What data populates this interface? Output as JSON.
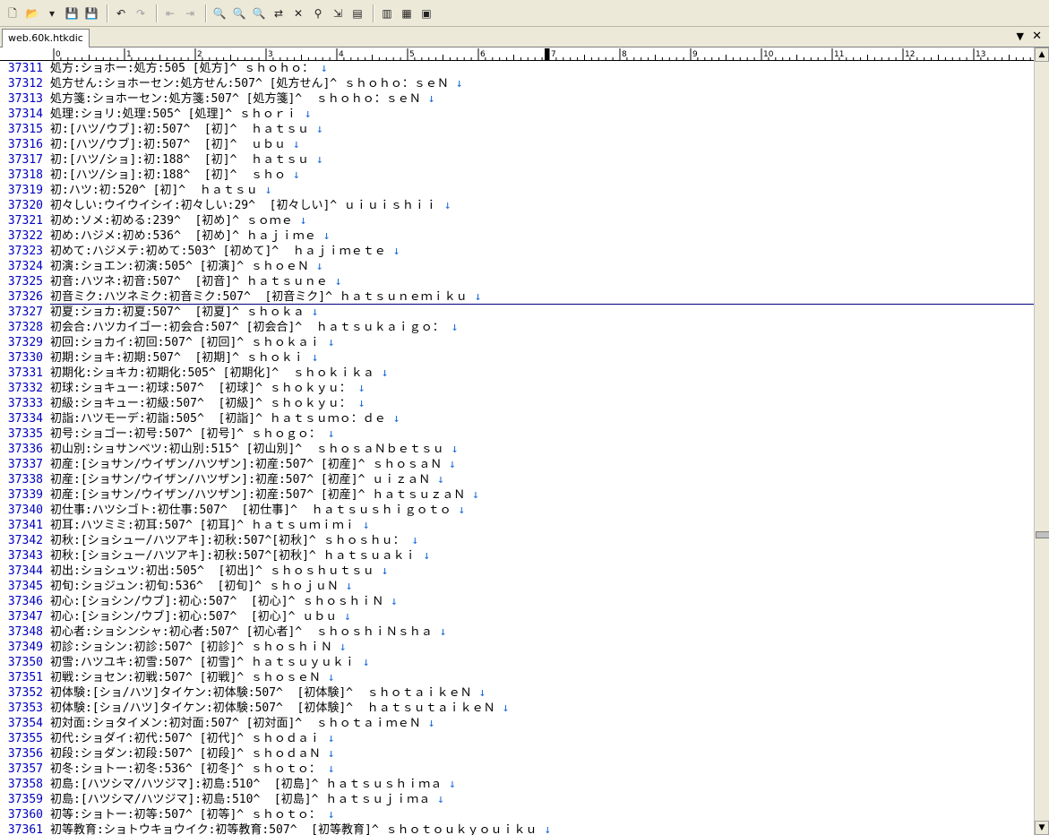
{
  "toolbar": {
    "buttons": [
      {
        "name": "new-file-icon",
        "glyph": "🗋",
        "enabled": true
      },
      {
        "name": "open-file-icon",
        "glyph": "📂",
        "enabled": true
      },
      {
        "name": "open-dropdown-icon",
        "glyph": "▾",
        "enabled": true
      },
      {
        "name": "save-icon",
        "glyph": "💾",
        "enabled": false
      },
      {
        "name": "save-all-icon",
        "glyph": "💾",
        "enabled": true
      },
      {
        "name": "undo-icon",
        "glyph": "↶",
        "enabled": true
      },
      {
        "name": "redo-icon",
        "glyph": "↷",
        "enabled": false
      },
      {
        "name": "back-icon",
        "glyph": "⇤",
        "enabled": false
      },
      {
        "name": "forward-icon",
        "glyph": "⇥",
        "enabled": false
      },
      {
        "name": "find-icon",
        "glyph": "🔍",
        "enabled": true
      },
      {
        "name": "find-next-icon",
        "glyph": "🔍",
        "enabled": true
      },
      {
        "name": "find-prev-icon",
        "glyph": "🔍",
        "enabled": true
      },
      {
        "name": "replace-icon",
        "glyph": "⇄",
        "enabled": true
      },
      {
        "name": "clear-highlight-icon",
        "glyph": "✕",
        "enabled": true
      },
      {
        "name": "grep-icon",
        "glyph": "⚲",
        "enabled": true
      },
      {
        "name": "tag-jump-icon",
        "glyph": "⇲",
        "enabled": true
      },
      {
        "name": "compare-icon",
        "glyph": "▤",
        "enabled": true
      },
      {
        "name": "outline-icon",
        "glyph": "▥",
        "enabled": true
      },
      {
        "name": "macro-icon",
        "glyph": "▦",
        "enabled": true
      },
      {
        "name": "settings-icon",
        "glyph": "▣",
        "enabled": true
      }
    ]
  },
  "tab": {
    "label": "web.60k.htkdic"
  },
  "ruler": {
    "labels": [
      "0",
      "1",
      "2",
      "3",
      "4",
      "5",
      "6",
      "7",
      "8",
      "9",
      "10",
      "11",
      "12",
      "13"
    ]
  },
  "editor": {
    "cursor_line": "37326",
    "lines": [
      {
        "n": "37311",
        "t": "処方:ショホー:処方:505 [処方]^ ｓｈｏｈｏ：",
        "e": " ↓"
      },
      {
        "n": "37312",
        "t": "処方せん:ショホーセン:処方せん:507^ [処方せん]^ ｓｈｏｈｏ：ｓｅＮ",
        "e": " ↓"
      },
      {
        "n": "37313",
        "t": "処方箋:ショホーセン:処方箋:507^ [処方箋]^  ｓｈｏｈｏ：ｓｅＮ",
        "e": " ↓"
      },
      {
        "n": "37314",
        "t": "処理:ショリ:処理:505^ [処理]^ ｓｈｏｒｉ",
        "e": " ↓"
      },
      {
        "n": "37315",
        "t": "初:[ハツ/ウブ]:初:507^  [初]^  ｈａｔｓｕ",
        "e": " ↓"
      },
      {
        "n": "37316",
        "t": "初:[ハツ/ウブ]:初:507^  [初]^  ｕｂｕ",
        "e": " ↓"
      },
      {
        "n": "37317",
        "t": "初:[ハツ/ショ]:初:188^  [初]^  ｈａｔｓｕ",
        "e": " ↓"
      },
      {
        "n": "37318",
        "t": "初:[ハツ/ショ]:初:188^  [初]^  ｓｈｏ",
        "e": " ↓"
      },
      {
        "n": "37319",
        "t": "初:ハツ:初:520^ [初]^  ｈａｔｓｕ",
        "e": " ↓"
      },
      {
        "n": "37320",
        "t": "初々しい:ウイウイシイ:初々しい:29^  [初々しい]^ ｕｉｕｉｓｈｉｉ",
        "e": " ↓"
      },
      {
        "n": "37321",
        "t": "初め:ソメ:初める:239^  [初め]^ ｓｏｍｅ",
        "e": " ↓"
      },
      {
        "n": "37322",
        "t": "初め:ハジメ:初め:536^  [初め]^ ｈａｊｉｍｅ",
        "e": " ↓"
      },
      {
        "n": "37323",
        "t": "初めて:ハジメテ:初めて:503^ [初めて]^  ｈａｊｉｍｅｔｅ",
        "e": " ↓"
      },
      {
        "n": "37324",
        "t": "初演:ショエン:初演:505^ [初演]^ ｓｈｏｅＮ",
        "e": " ↓"
      },
      {
        "n": "37325",
        "t": "初音:ハツネ:初音:507^  [初音]^ ｈａｔｓｕｎｅ",
        "e": " ↓"
      },
      {
        "n": "37326",
        "t": "初音ミク:ハツネミク:初音ミク:507^  [初音ミク]^ ｈａｔｓｕｎｅｍｉｋｕ",
        "e": " ↓"
      },
      {
        "n": "37327",
        "t": "初夏:ショカ:初夏:507^  [初夏]^ ｓｈｏｋａ",
        "e": " ↓"
      },
      {
        "n": "37328",
        "t": "初会合:ハツカイゴー:初会合:507^ [初会合]^  ｈａｔｓｕｋａｉｇｏ：",
        "e": " ↓"
      },
      {
        "n": "37329",
        "t": "初回:ショカイ:初回:507^ [初回]^ ｓｈｏｋａｉ",
        "e": " ↓"
      },
      {
        "n": "37330",
        "t": "初期:ショキ:初期:507^  [初期]^ ｓｈｏｋｉ",
        "e": " ↓"
      },
      {
        "n": "37331",
        "t": "初期化:ショキカ:初期化:505^ [初期化]^  ｓｈｏｋｉｋａ",
        "e": " ↓"
      },
      {
        "n": "37332",
        "t": "初球:ショキュー:初球:507^  [初球]^ ｓｈｏｋｙｕ：",
        "e": " ↓"
      },
      {
        "n": "37333",
        "t": "初級:ショキュー:初級:507^  [初級]^ ｓｈｏｋｙｕ：",
        "e": " ↓"
      },
      {
        "n": "37334",
        "t": "初詣:ハツモーデ:初詣:505^  [初詣]^ ｈａｔｓｕｍｏ：ｄｅ",
        "e": " ↓"
      },
      {
        "n": "37335",
        "t": "初号:ショゴー:初号:507^ [初号]^ ｓｈｏｇｏ：",
        "e": " ↓"
      },
      {
        "n": "37336",
        "t": "初山別:ショサンベツ:初山別:515^ [初山別]^  ｓｈｏｓａＮｂｅｔｓｕ",
        "e": " ↓"
      },
      {
        "n": "37337",
        "t": "初産:[ショサン/ウイザン/ハツザン]:初産:507^ [初産]^ ｓｈｏｓａＮ",
        "e": " ↓"
      },
      {
        "n": "37338",
        "t": "初産:[ショサン/ウイザン/ハツザン]:初産:507^ [初産]^ ｕｉｚａＮ",
        "e": " ↓"
      },
      {
        "n": "37339",
        "t": "初産:[ショサン/ウイザン/ハツザン]:初産:507^ [初産]^ ｈａｔｓｕｚａＮ",
        "e": " ↓"
      },
      {
        "n": "37340",
        "t": "初仕事:ハツシゴト:初仕事:507^  [初仕事]^  ｈａｔｓｕｓｈｉｇｏｔｏ",
        "e": " ↓"
      },
      {
        "n": "37341",
        "t": "初耳:ハツミミ:初耳:507^ [初耳]^ ｈａｔｓｕｍｉｍｉ",
        "e": " ↓"
      },
      {
        "n": "37342",
        "t": "初秋:[ショシュー/ハツアキ]:初秋:507^[初秋]^ ｓｈｏｓｈｕ：",
        "e": " ↓"
      },
      {
        "n": "37343",
        "t": "初秋:[ショシュー/ハツアキ]:初秋:507^[初秋]^ ｈａｔｓｕａｋｉ",
        "e": " ↓"
      },
      {
        "n": "37344",
        "t": "初出:ショシュツ:初出:505^  [初出]^ ｓｈｏｓｈｕｔｓｕ",
        "e": " ↓"
      },
      {
        "n": "37345",
        "t": "初旬:ショジュン:初旬:536^  [初旬]^ ｓｈｏｊｕＮ",
        "e": " ↓"
      },
      {
        "n": "37346",
        "t": "初心:[ショシン/ウブ]:初心:507^  [初心]^ ｓｈｏｓｈｉＮ",
        "e": " ↓"
      },
      {
        "n": "37347",
        "t": "初心:[ショシン/ウブ]:初心:507^  [初心]^ ｕｂｕ",
        "e": " ↓"
      },
      {
        "n": "37348",
        "t": "初心者:ショシンシャ:初心者:507^ [初心者]^  ｓｈｏｓｈｉＮｓｈａ",
        "e": " ↓"
      },
      {
        "n": "37349",
        "t": "初診:ショシン:初診:507^ [初診]^ ｓｈｏｓｈｉＮ",
        "e": " ↓"
      },
      {
        "n": "37350",
        "t": "初雪:ハツユキ:初雪:507^ [初雪]^ ｈａｔｓｕｙｕｋｉ",
        "e": " ↓"
      },
      {
        "n": "37351",
        "t": "初戦:ショセン:初戦:507^ [初戦]^ ｓｈｏｓｅＮ",
        "e": " ↓"
      },
      {
        "n": "37352",
        "t": "初体験:[ショ/ハツ]タイケン:初体験:507^  [初体験]^  ｓｈｏｔａｉｋｅＮ",
        "e": " ↓"
      },
      {
        "n": "37353",
        "t": "初体験:[ショ/ハツ]タイケン:初体験:507^  [初体験]^  ｈａｔｓｕｔａｉｋｅＮ",
        "e": " ↓"
      },
      {
        "n": "37354",
        "t": "初対面:ショタイメン:初対面:507^ [初対面]^  ｓｈｏｔａｉｍｅＮ",
        "e": " ↓"
      },
      {
        "n": "37355",
        "t": "初代:ショダイ:初代:507^ [初代]^ ｓｈｏｄａｉ",
        "e": " ↓"
      },
      {
        "n": "37356",
        "t": "初段:ショダン:初段:507^ [初段]^ ｓｈｏｄａＮ",
        "e": " ↓"
      },
      {
        "n": "37357",
        "t": "初冬:ショトー:初冬:536^ [初冬]^ ｓｈｏｔｏ：",
        "e": " ↓"
      },
      {
        "n": "37358",
        "t": "初島:[ハツシマ/ハツジマ]:初島:510^  [初島]^ ｈａｔｓｕｓｈｉｍａ",
        "e": " ↓"
      },
      {
        "n": "37359",
        "t": "初島:[ハツシマ/ハツジマ]:初島:510^  [初島]^ ｈａｔｓｕｊｉｍａ",
        "e": " ↓"
      },
      {
        "n": "37360",
        "t": "初等:ショトー:初等:507^ [初等]^ ｓｈｏｔｏ：",
        "e": " ↓"
      },
      {
        "n": "37361",
        "t": "初等教育:ショトウキョウイク:初等教育:507^  [初等教育]^ ｓｈｏｔｏｕｋｙｏｕｉｋｕ",
        "e": " ↓"
      }
    ]
  }
}
